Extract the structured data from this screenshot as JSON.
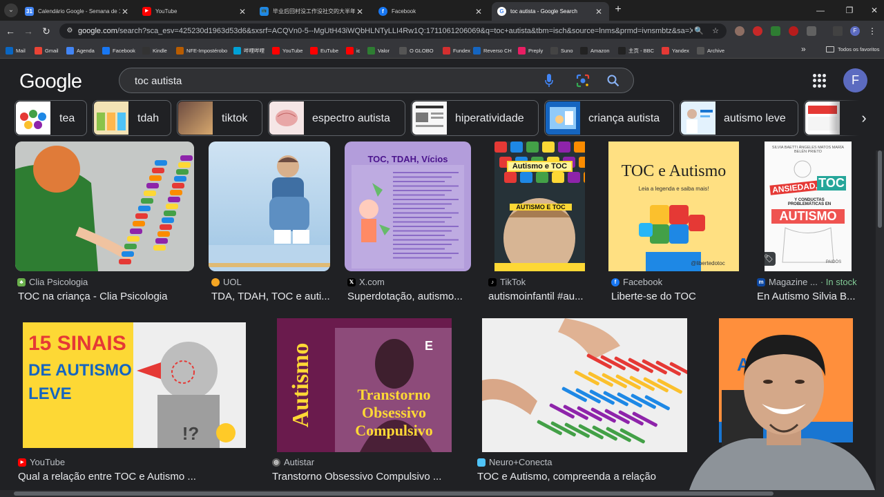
{
  "browser": {
    "tabs": [
      {
        "title": "Calendário Google - Semana de 17 de",
        "color": "#4285f4",
        "glyph": "31"
      },
      {
        "title": "YouTube",
        "color": "#ff0000",
        "glyph": "▶"
      },
      {
        "title": "毕业后回村没工作没社交的大半年, 来",
        "color": "#1e88e5",
        "glyph": "📺"
      },
      {
        "title": "Facebook",
        "color": "#1877f2",
        "glyph": "f"
      },
      {
        "title": "toc autista - Google Search",
        "color": "#ffffff",
        "glyph": "G"
      }
    ],
    "url_host": "google.com",
    "url_rest": "/search?sca_esv=425230d1963d53d6&sxsrf=ACQVn0-5--MgUtH43iWQbHLNTyLLI4Rw1Q:1711061206069&q=toc+autista&tbm=isch&source=lnms&prmd=ivnsmbtz&sa=X&ved=2ahUK...",
    "bookmarks": [
      {
        "label": "Mail",
        "color": "#0a66c2"
      },
      {
        "label": "Gmail",
        "color": "#ea4335"
      },
      {
        "label": "Agenda",
        "color": "#4285f4"
      },
      {
        "label": "Facebook",
        "color": "#1877f2"
      },
      {
        "label": "Kindle",
        "color": "#333333"
      },
      {
        "label": "NFE-Impostérobo",
        "color": "#b85c00"
      },
      {
        "label": "哔哩哔哩",
        "color": "#00a1d6"
      },
      {
        "label": "YouTube",
        "color": "#ff0000"
      },
      {
        "label": "EuTube",
        "color": "#ff0000"
      },
      {
        "label": "ic",
        "color": "#ff0000"
      },
      {
        "label": "Valor",
        "color": "#2e7d32"
      },
      {
        "label": "O GLOBO",
        "color": "#555555"
      },
      {
        "label": "Fundex",
        "color": "#d32f2f"
      },
      {
        "label": "Reverso CH",
        "color": "#1565c0"
      },
      {
        "label": "Preply",
        "color": "#e91e63"
      },
      {
        "label": "Suno",
        "color": "#444444"
      },
      {
        "label": "Amazon",
        "color": "#222222"
      },
      {
        "label": "主页 - BBC",
        "color": "#222222"
      },
      {
        "label": "Yandex",
        "color": "#e53935"
      },
      {
        "label": "Archive",
        "color": "#555555"
      }
    ],
    "all_bookmarks": "Todos os favoritos",
    "avatar_letter": "F"
  },
  "google": {
    "logo": "Google",
    "query": "toc autista",
    "avatar_letter": "F"
  },
  "chips": [
    {
      "label": "tea"
    },
    {
      "label": "tdah"
    },
    {
      "label": "tiktok"
    },
    {
      "label": "espectro autista"
    },
    {
      "label": "hiperatividade"
    },
    {
      "label": "criança autista"
    },
    {
      "label": "autismo leve"
    },
    {
      "label": ""
    }
  ],
  "results": [
    {
      "source": "Clia Psicologia",
      "title": "TOC na criança - Clia Psicologia",
      "color": "#6ab04c"
    },
    {
      "source": "UOL",
      "title": "TDA, TDAH, TOC e auti...",
      "color": "#f5a623"
    },
    {
      "source": "X.com",
      "title": "Superdotação, autismo...",
      "color": "#000000"
    },
    {
      "source": "TikTok",
      "title": "autismoinfantil #au...",
      "color": "#000000"
    },
    {
      "source": "Facebook",
      "title": "Liberte-se do TOC",
      "color": "#1877f2"
    },
    {
      "source": "Magazine ...",
      "instock": "· In stock",
      "title": "En Autismo Silvia B...",
      "color": "#0d47a1"
    },
    {
      "source": "YouTube",
      "title": "Qual a relação entre TOC e Autismo ...",
      "color": "#ff0000"
    },
    {
      "source": "Autistar",
      "title": "Transtorno Obsessivo Compulsivo ...",
      "color": "#9e9e9e"
    },
    {
      "source": "Neuro+Conecta",
      "title": "TOC e Autismo, compreenda a relação",
      "color": "#4fc3f7"
    }
  ],
  "image_text": {
    "r3_title": "TOC, TDAH, Vícios",
    "r4_top": "Autismo e TOC",
    "r4_mid": "AUTISMO E TOC",
    "r5_title": "TOC e Autismo",
    "r5_sub": "Leia a legenda e saiba mais!",
    "r5_handle": "@libertedotoc",
    "r6_authors": "SILVIA BAETTI  ÁNGELES MATOS  MARÍA BELÉN PRIETO",
    "r6_title1": "ANSIEDAD,",
    "r6_title2": "TOC",
    "r6_title3": "Y CONDUCTAS PROBLEMÁTICAS EN",
    "r6_title4": "AUTISMO",
    "r6_pub": "PAIDÓS",
    "r7_line1": "15 SINAIS",
    "r7_line2": "DE AUTISMO",
    "r7_line3": "LEVE",
    "r7_mark": "!?",
    "r8_vertical": "Autismo",
    "r8_e": "E",
    "r8_line1": "Transtorno",
    "r8_line2": "Obsessivo",
    "r8_line3": "Compulsivo",
    "r9_partial": "AU"
  }
}
